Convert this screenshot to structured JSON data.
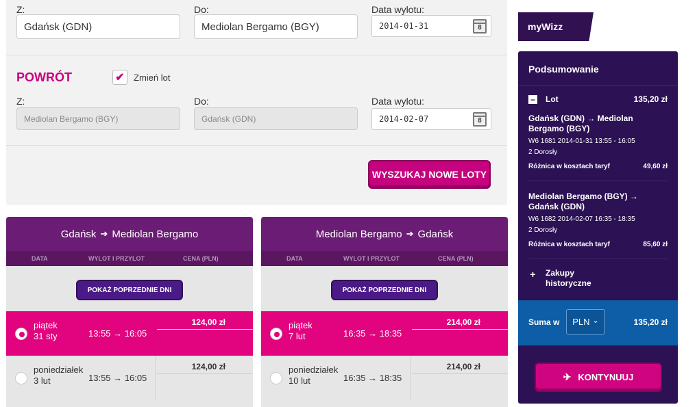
{
  "outbound": {
    "from_label": "Z:",
    "from_value": "Gdańsk (GDN)",
    "to_label": "Do:",
    "to_value": "Mediolan Bergamo (BGY)",
    "date_label": "Data wylotu:",
    "date_value": "2014-01-31",
    "calendar_day": "8"
  },
  "return": {
    "title": "POWRÓT",
    "change_label": "Zmień lot",
    "change_checked": true,
    "from_label": "Z:",
    "from_value": "Mediolan Bergamo (BGY)",
    "to_label": "Do:",
    "to_value": "Gdańsk (GDN)",
    "date_label": "Data wylotu:",
    "date_value": "2014-02-07",
    "calendar_day": "8"
  },
  "search_button": "WYSZUKAJ NOWE LOTY",
  "flight_columns": [
    {
      "origin": "Gdańsk",
      "destination": "Mediolan Bergamo",
      "arrow": "➔",
      "col_headers": [
        "DATA",
        "WYLOT I PRZYLOT",
        "CENA (PLN)"
      ],
      "prev_button": "POKAŻ POPRZEDNIE DNI",
      "rows": [
        {
          "day": "piątek",
          "date": "31 sty",
          "times": "13:55 → 16:05",
          "price": "124,00 zł",
          "selected": true
        },
        {
          "day": "poniedziałek",
          "date": "3 lut",
          "times": "13:55 → 16:05",
          "price": "124,00 zł",
          "selected": false
        }
      ]
    },
    {
      "origin": "Mediolan Bergamo",
      "destination": "Gdańsk",
      "arrow": "➔",
      "col_headers": [
        "DATA",
        "WYLOT I PRZYLOT",
        "CENA (PLN)"
      ],
      "prev_button": "POKAŻ POPRZEDNIE DNI",
      "rows": [
        {
          "day": "piątek",
          "date": "7 lut",
          "times": "16:35 → 18:35",
          "price": "214,00 zł",
          "selected": true
        },
        {
          "day": "poniedziałek",
          "date": "10 lut",
          "times": "16:35 → 18:35",
          "price": "214,00 zł",
          "selected": false
        }
      ]
    }
  ],
  "mywizz": "myWizz",
  "summary": {
    "title": "Podsumowanie",
    "flight_label": "Lot",
    "flight_total": "135,20 zł",
    "toggle_minus": "−",
    "toggle_plus": "+",
    "legs": [
      {
        "route": "Gdańsk (GDN) → Mediolan Bergamo (BGY)",
        "flight_info": "W6 1681  2014-01-31 13:55 - 16:05",
        "passengers": "2 Dorosły",
        "diff_label": "Różnica w kosztach taryf",
        "diff_value": "49,60 zł"
      },
      {
        "route": "Mediolan Bergamo (BGY) → Gdańsk (GDN)",
        "flight_info": "W6 1682  2014-02-07 16:35 - 18:35",
        "passengers": "2 Dorosły",
        "diff_label": "Różnica w kosztach taryf",
        "diff_value": "85,60 zł"
      }
    ],
    "history_label": "Zakupy historyczne",
    "sum_label": "Suma w",
    "currency": "PLN",
    "currency_caret": "⌄",
    "sum_value": "135,20 zł",
    "continue_button": "KONTYNUUJ",
    "plane_icon": "✈"
  },
  "colors": {
    "accent_pink": "#c6037e",
    "selected_row": "#e2037e",
    "purple_header": "#6b1c74",
    "summary_bg": "#2c1254",
    "total_blue": "#0d5ea6"
  }
}
